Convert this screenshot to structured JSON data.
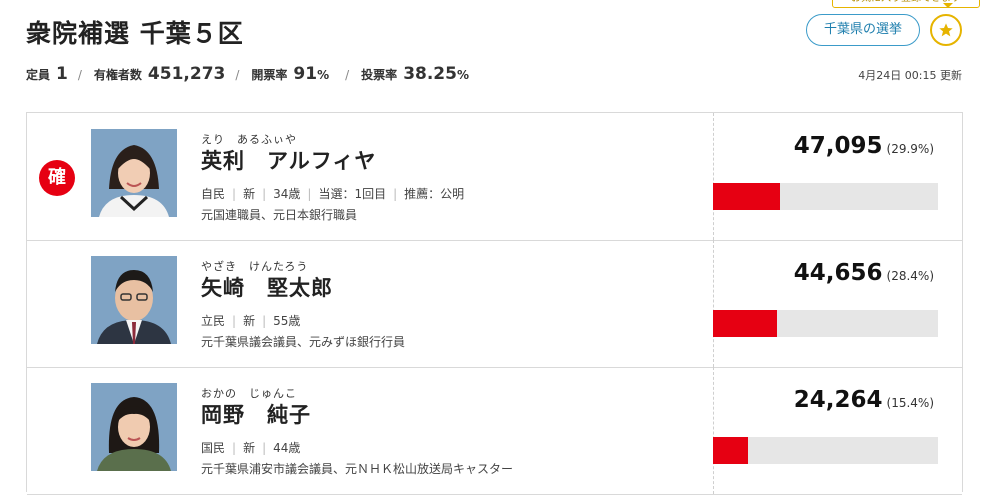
{
  "header": {
    "title": "衆院補選 千葉５区",
    "tooltip": "お気に入り登録できます",
    "pref_button": "千葉県の選挙",
    "star_icon": "star-icon"
  },
  "stats": {
    "seats_label": "定員",
    "seats": "1",
    "voters_label": "有権者数",
    "voters": "451,273",
    "counted_label": "開票率",
    "counted": "91",
    "counted_unit": "%",
    "turnout_label": "投票率",
    "turnout": "38.25",
    "turnout_unit": "%",
    "updated": "4月24日 00:15 更新"
  },
  "colors": {
    "accent": "#e60012",
    "bar_bg": "#e6e6e6",
    "link": "#1f7fae",
    "star": "#e6b400"
  },
  "candidates": [
    {
      "elected_badge": "確",
      "furigana": "えり　あるふぃや",
      "name": "英利　アルフィヤ",
      "party": "自民",
      "status": "新",
      "age": "34歳",
      "wins": "当選：1回目",
      "endorse": "推薦：公明",
      "career": "元国連職員、元日本銀行職員",
      "votes": "47,095",
      "pct": "(29.9%)",
      "share": 0.299
    },
    {
      "furigana": "やざき　けんたろう",
      "name": "矢崎　堅太郎",
      "party": "立民",
      "status": "新",
      "age": "55歳",
      "career": "元千葉県議会議員、元みずほ銀行行員",
      "votes": "44,656",
      "pct": "(28.4%)",
      "share": 0.284
    },
    {
      "furigana": "おかの　じゅんこ",
      "name": "岡野　純子",
      "party": "国民",
      "status": "新",
      "age": "44歳",
      "career": "元千葉県浦安市議会議員、元ＮＨＫ松山放送局キャスター",
      "votes": "24,264",
      "pct": "(15.4%)",
      "share": 0.154
    }
  ]
}
